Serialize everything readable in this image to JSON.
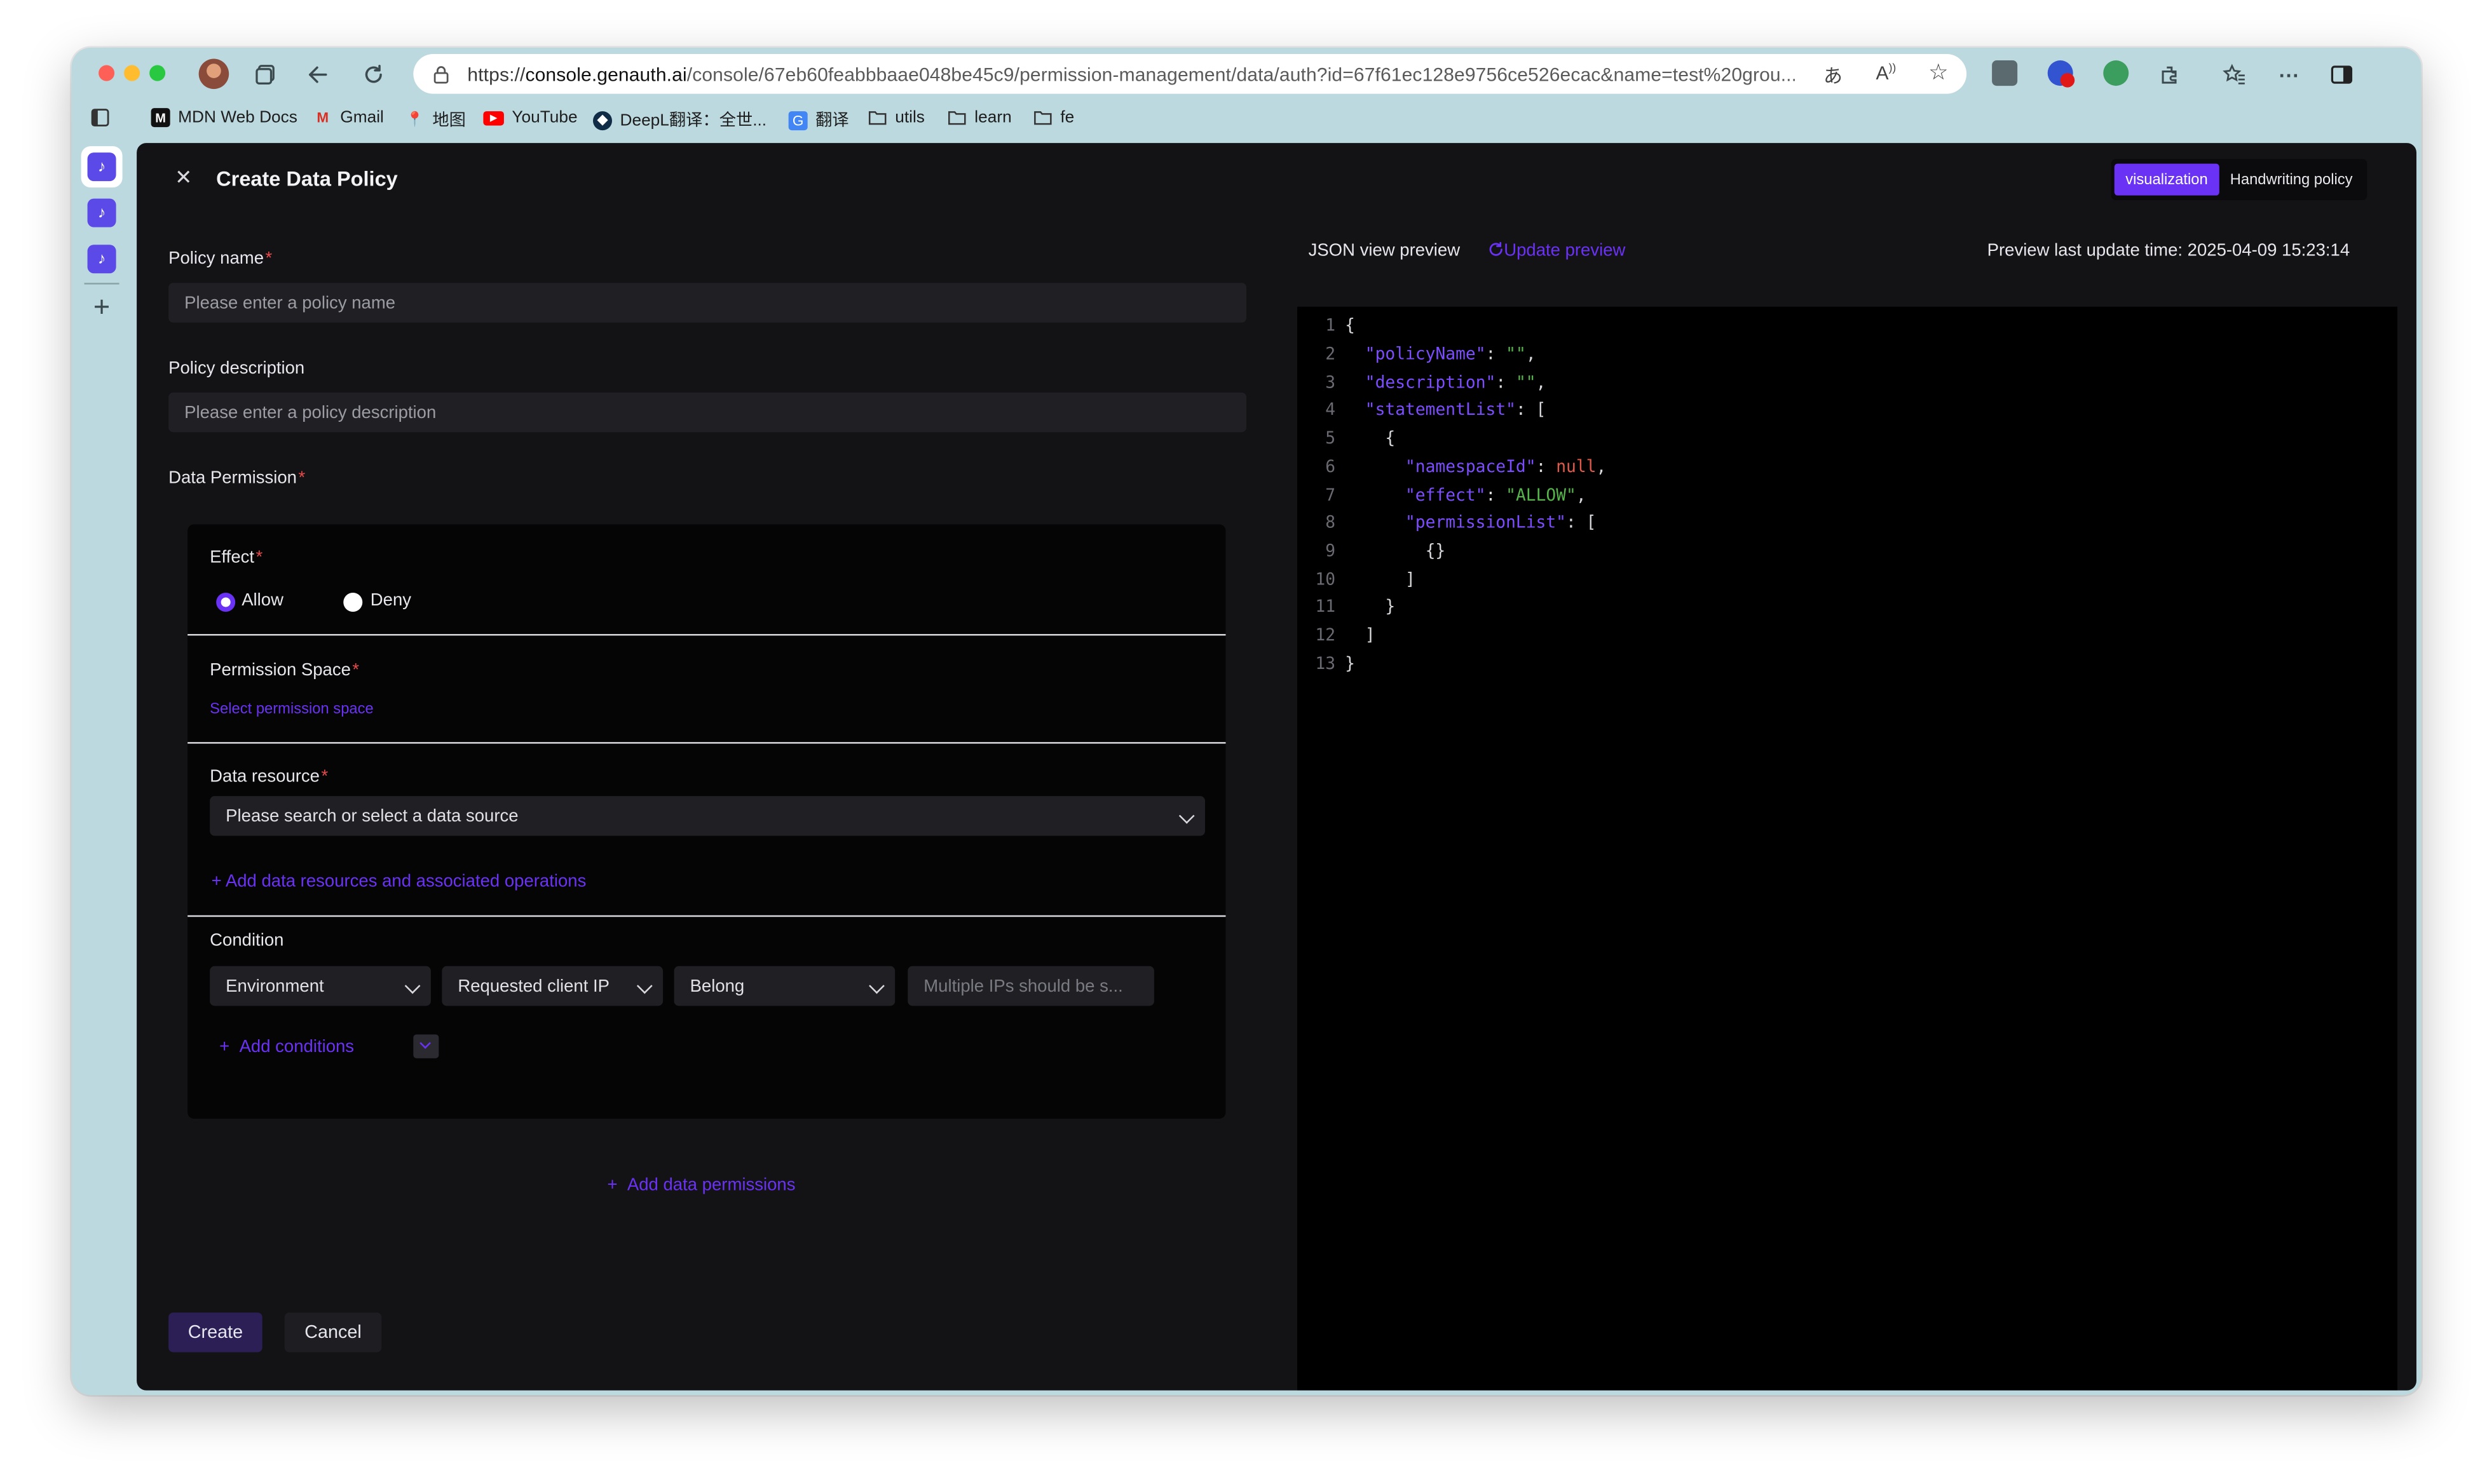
{
  "browser": {
    "url_scheme": "https://",
    "url_host": "console.genauth.ai",
    "url_path": "/console/67eb60feabbbaae048be45c9/permission-management/data/auth?id=67f61ec128e9756ce526ecac&name=test%20grou...",
    "bookmarks": [
      "MDN Web Docs",
      "Gmail",
      "地图",
      "YouTube",
      "DeepL翻译：全世...",
      "翻译",
      "utils",
      "learn",
      "fe"
    ]
  },
  "dialog": {
    "title": "Create Data Policy",
    "mode_visual": "visualization",
    "mode_handwriting": "Handwriting policy"
  },
  "form": {
    "policy_name_label": "Policy name",
    "policy_name_placeholder": "Please enter a policy name",
    "policy_desc_label": "Policy description",
    "policy_desc_placeholder": "Please enter a policy description",
    "data_permission_label": "Data Permission",
    "effect_label": "Effect",
    "allow_label": "Allow",
    "deny_label": "Deny",
    "permission_space_label": "Permission Space",
    "select_space_link": "Select permission space",
    "data_resource_label": "Data resource",
    "data_source_placeholder": "Please search or select a data source",
    "add_resources_link": "Add data resources and associated operations",
    "condition_label": "Condition",
    "condition_type": "Environment",
    "condition_attr": "Requested client IP",
    "condition_op": "Belong",
    "condition_value_placeholder": "Multiple IPs should be s...",
    "add_conditions_link": "Add conditions",
    "add_permissions_link": "Add data permissions",
    "create_button": "Create",
    "cancel_button": "Cancel"
  },
  "preview": {
    "title": "JSON view preview",
    "update_link": "Update preview",
    "last_update_prefix": "Preview last update time: ",
    "last_update_time": "2025-04-09 15:23:14"
  },
  "code_lines": [
    "{",
    "  \"policyName\": \"\",",
    "  \"description\": \"\",",
    "  \"statementList\": [",
    "    {",
    "      \"namespaceId\": null,",
    "      \"effect\": \"ALLOW\",",
    "      \"permissionList\": [",
    "        {}",
    "      ]",
    "    }",
    "  ]",
    "}"
  ],
  "colors": {
    "accent": "#6a32f5",
    "panel_bg": "#131316",
    "code_bg": "#000000",
    "browser_chrome": "#bcd9df"
  }
}
